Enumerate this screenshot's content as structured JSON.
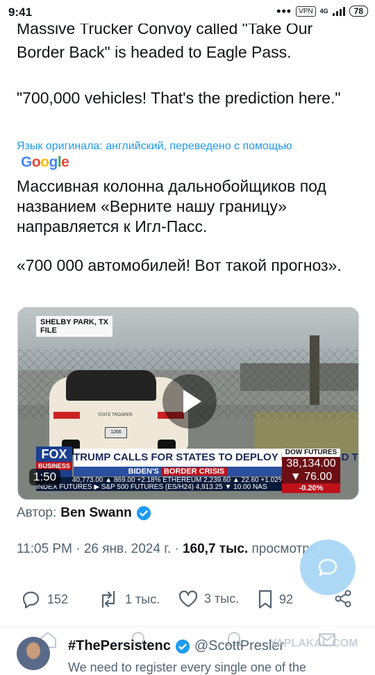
{
  "status_bar": {
    "time": "9:41",
    "network_badge": "VPN",
    "signal": "4G",
    "battery": "78"
  },
  "tweet": {
    "original_para1": "Massive Trucker Convoy called \"Take Our Border Back\" is headed to Eagle Pass.",
    "original_para2": "\"700,000 vehicles! That's the prediction here.\"",
    "translation_note": "Язык оригинала: английский, переведено с помощью",
    "translation_provider": "Google",
    "translated_para1": "Массивная колонна дальнобойщиков под названием «Верните нашу границу» направляется к Игл-Пасс.",
    "translated_para2": "«700 000 автомобилей! Вот такой прогноз»."
  },
  "video": {
    "location_tag_line1": "SHELBY PARK, TX",
    "location_tag_line2": "FILE",
    "network_logo": "FOX",
    "network_logo_sub": "BUSINESS",
    "headline": "TRUMP CALLS FOR STATES TO DEPLOY NATL GUARD TO TX",
    "banner_prefix": "BIDEN'S",
    "banner_highlight": "BORDER CRISIS",
    "ticker_line1": "40,773.00  ▲ 869.00 +2.18%  ETHEREUM  2,239.60  ▲ 22.60 +1.02%",
    "ticker_line2": "INDEX FUTURES ▶  S&P 500 FUTURES (ES/H24)  4,913.25  ▼ 10.00  NAS",
    "dow_label": "DOW FUTURES",
    "dow_value": "38,134.00",
    "dow_change": "▼ 76.00",
    "dow_percent": "-0.20%",
    "duration": "1:50",
    "car_text": "STATE TROOPER",
    "plate": "1266"
  },
  "author": {
    "label": "Автор:",
    "name": "Ben Swann"
  },
  "meta": {
    "time": "11:05 PM",
    "date": "26 янв. 2024 г.",
    "views_count": "160,7 тыс.",
    "views_label": "просмотра"
  },
  "actions": {
    "replies": "152",
    "reposts": "1 тыс.",
    "likes": "3 тыс.",
    "bookmarks": "92"
  },
  "next_tweet": {
    "display_name": "#ThePersistenc",
    "handle": "@ScottPresler",
    "snippet": "We need to register every single one of the"
  },
  "watermark": "YAPLAKAL.COM",
  "colors": {
    "accent": "#1d9bf0",
    "text": "#0f1419",
    "secondary": "#536471"
  }
}
